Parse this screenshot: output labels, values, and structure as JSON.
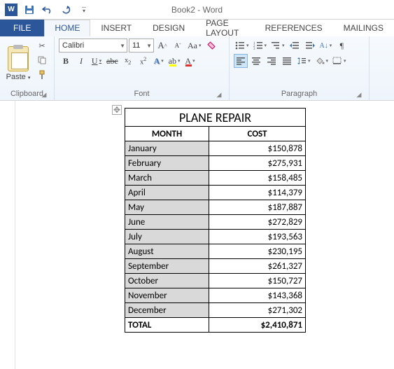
{
  "title": "Book2 - Word",
  "qat": {
    "save": "save",
    "undo": "undo",
    "redo": "redo",
    "customize": "customize"
  },
  "tabs": {
    "file": "FILE",
    "home": "HOME",
    "insert": "INSERT",
    "design": "DESIGN",
    "page_layout": "PAGE LAYOUT",
    "references": "REFERENCES",
    "mailings": "MAILINGS"
  },
  "ribbon": {
    "clipboard": {
      "paste": "Paste",
      "label": "Clipboard"
    },
    "font": {
      "name": "Calibri",
      "size": "11",
      "label": "Font",
      "bold": "B",
      "italic": "I",
      "underline": "U",
      "case": "Aa",
      "x2": "x",
      "abc": "abc",
      "A_big": "A",
      "A_small": "A",
      "A_effects": "A",
      "ab_highlight": "ab",
      "A_color": "A"
    },
    "paragraph": {
      "label": "Paragraph",
      "pilcrow": "¶"
    }
  },
  "document": {
    "table_title": "PLANE REPAIR",
    "col_month": "MONTH",
    "col_cost": "COST",
    "rows": [
      {
        "month": "January",
        "cost": "$150,878"
      },
      {
        "month": "February",
        "cost": "$275,931"
      },
      {
        "month": "March",
        "cost": "$158,485"
      },
      {
        "month": "April",
        "cost": "$114,379"
      },
      {
        "month": "May",
        "cost": "$187,887"
      },
      {
        "month": "June",
        "cost": "$272,829"
      },
      {
        "month": "July",
        "cost": "$193,563"
      },
      {
        "month": "August",
        "cost": "$230,195"
      },
      {
        "month": "September",
        "cost": "$261,327"
      },
      {
        "month": "October",
        "cost": "$150,727"
      },
      {
        "month": "November",
        "cost": "$143,368"
      },
      {
        "month": "December",
        "cost": "$271,302"
      }
    ],
    "total_label": "TOTAL",
    "total_value": "$2,410,871"
  },
  "chart_data": {
    "type": "table",
    "title": "PLANE REPAIR",
    "columns": [
      "MONTH",
      "COST"
    ],
    "rows": [
      [
        "January",
        150878
      ],
      [
        "February",
        275931
      ],
      [
        "March",
        158485
      ],
      [
        "April",
        114379
      ],
      [
        "May",
        187887
      ],
      [
        "June",
        272829
      ],
      [
        "July",
        193563
      ],
      [
        "August",
        230195
      ],
      [
        "September",
        261327
      ],
      [
        "October",
        150727
      ],
      [
        "November",
        143368
      ],
      [
        "December",
        271302
      ]
    ],
    "total": 2410871
  }
}
